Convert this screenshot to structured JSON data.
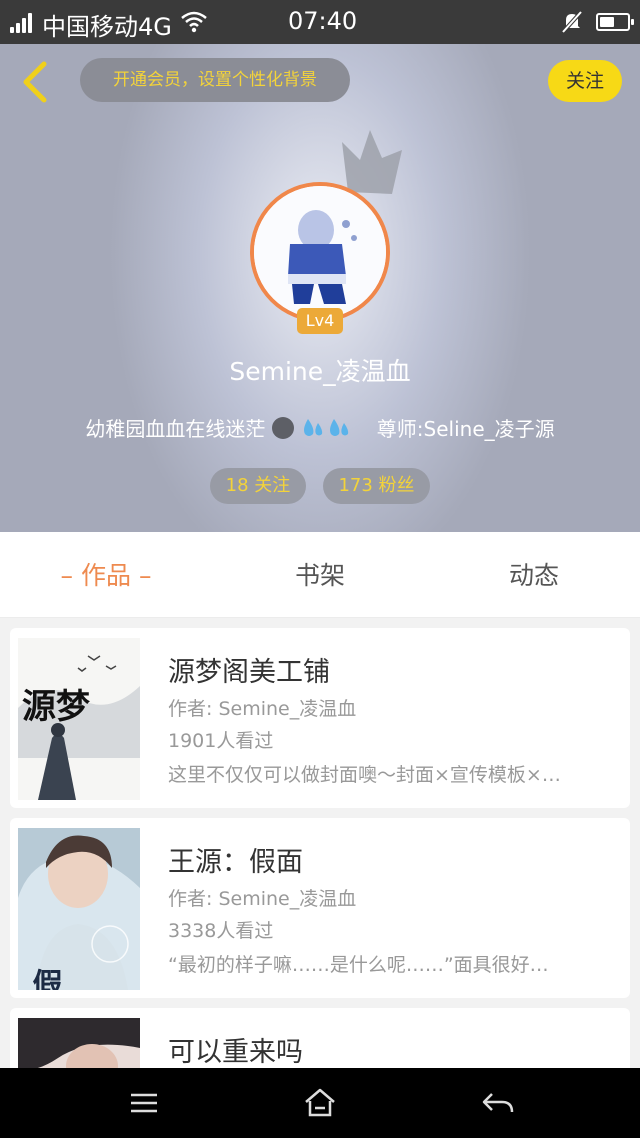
{
  "status_bar": {
    "carrier": "中国移动4G",
    "time": "07:40",
    "battery_level": 0.55
  },
  "header": {
    "vip_banner": "开通会员，设置个性化背景",
    "follow_label": "关注",
    "level": "Lv4",
    "username": "Semine_凌温血",
    "bio_prefix": "幼稚园血血在线迷茫",
    "bio_suffix": "尊师:Seline_凌子源",
    "stats": {
      "following": "18 关注",
      "followers": "173 粉丝"
    }
  },
  "tabs": [
    {
      "label": "– 作品 –",
      "active": true
    },
    {
      "label": "书架",
      "active": false
    },
    {
      "label": "动态",
      "active": false
    }
  ],
  "books": [
    {
      "title": "源梦阁美工铺",
      "author": "作者: Semine_凌温血",
      "readers": "1901人看过",
      "description": "这里不仅仅可以做封面噢～封面×宣传模板×…",
      "cover_text": "源梦"
    },
    {
      "title": "王源：假面",
      "author": "作者: Semine_凌温血",
      "readers": "3338人看过",
      "description": "“最初的样子嘛……是什么呢……”面具很好…",
      "cover_text": "假面"
    },
    {
      "title": "可以重来吗",
      "author": "",
      "readers": "",
      "description": "",
      "cover_text": ""
    }
  ],
  "colors": {
    "accent_orange": "#ee8a4f",
    "follow_yellow": "#f7d916",
    "vip_text": "#f3d33a"
  }
}
